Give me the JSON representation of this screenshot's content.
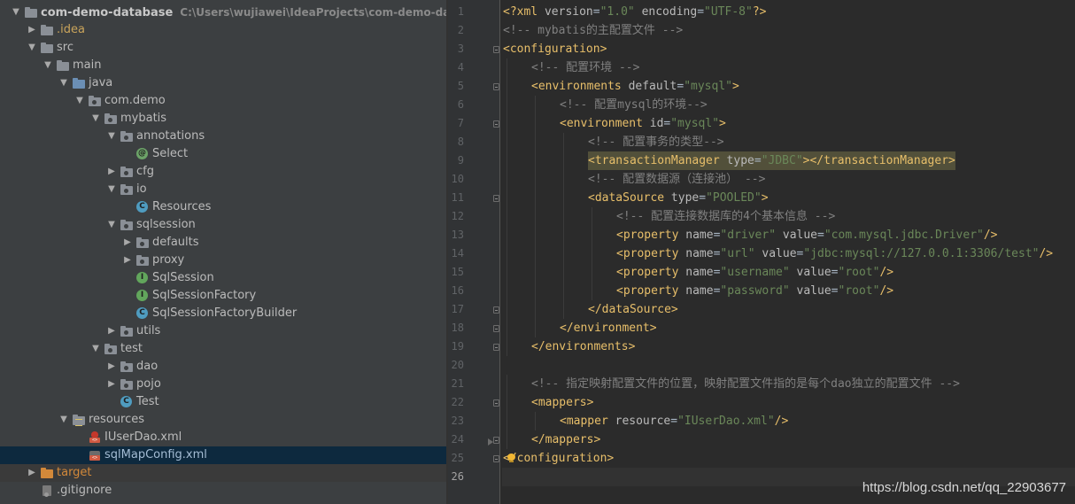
{
  "colors": {
    "tree_bg": "#3c3f41",
    "editor_bg": "#2b2b2b",
    "gutter_bg": "#313335",
    "selection": "#0d293e",
    "tag": "#e8bf6a",
    "attr_value": "#6a8759",
    "comment": "#808080"
  },
  "tree": {
    "project_name": "com-demo-database",
    "project_path": "C:\\Users\\wujiawei\\IdeaProjects\\com-demo-database",
    "items": [
      {
        "label": "com-demo-database",
        "depth": 0,
        "expanded": true,
        "icon": "project-folder-icon",
        "name": "tree-item-project-root"
      },
      {
        "label": ".idea",
        "depth": 1,
        "expanded": false,
        "icon": "folder-icon",
        "name": "tree-item-idea"
      },
      {
        "label": "src",
        "depth": 1,
        "expanded": true,
        "icon": "folder-icon",
        "name": "tree-item-src"
      },
      {
        "label": "main",
        "depth": 2,
        "expanded": true,
        "icon": "folder-icon",
        "name": "tree-item-main"
      },
      {
        "label": "java",
        "depth": 3,
        "expanded": true,
        "icon": "source-root-folder-icon",
        "name": "tree-item-java"
      },
      {
        "label": "com.demo",
        "depth": 4,
        "expanded": true,
        "icon": "package-icon",
        "name": "tree-item-com-demo"
      },
      {
        "label": "mybatis",
        "depth": 5,
        "expanded": true,
        "icon": "package-icon",
        "name": "tree-item-mybatis"
      },
      {
        "label": "annotations",
        "depth": 6,
        "expanded": true,
        "icon": "package-icon",
        "name": "tree-item-annotations"
      },
      {
        "label": "Select",
        "depth": 7,
        "expanded": null,
        "icon": "annotation-icon",
        "name": "tree-item-select"
      },
      {
        "label": "cfg",
        "depth": 6,
        "expanded": false,
        "icon": "package-icon",
        "name": "tree-item-cfg"
      },
      {
        "label": "io",
        "depth": 6,
        "expanded": true,
        "icon": "package-icon",
        "name": "tree-item-io"
      },
      {
        "label": "Resources",
        "depth": 7,
        "expanded": null,
        "icon": "class-icon",
        "name": "tree-item-resources-class"
      },
      {
        "label": "sqlsession",
        "depth": 6,
        "expanded": true,
        "icon": "package-icon",
        "name": "tree-item-sqlsession"
      },
      {
        "label": "defaults",
        "depth": 7,
        "expanded": false,
        "icon": "package-icon",
        "name": "tree-item-defaults"
      },
      {
        "label": "proxy",
        "depth": 7,
        "expanded": false,
        "icon": "package-icon",
        "name": "tree-item-proxy"
      },
      {
        "label": "SqlSession",
        "depth": 7,
        "expanded": null,
        "icon": "interface-icon",
        "name": "tree-item-sqlsession-interface"
      },
      {
        "label": "SqlSessionFactory",
        "depth": 7,
        "expanded": null,
        "icon": "interface-icon",
        "name": "tree-item-sqlsessionfactory"
      },
      {
        "label": "SqlSessionFactoryBuilder",
        "depth": 7,
        "expanded": null,
        "icon": "class-icon",
        "name": "tree-item-sqlsessionfactorybuilder"
      },
      {
        "label": "utils",
        "depth": 6,
        "expanded": false,
        "icon": "package-icon",
        "name": "tree-item-utils"
      },
      {
        "label": "test",
        "depth": 5,
        "expanded": true,
        "icon": "package-icon",
        "name": "tree-item-test-pkg"
      },
      {
        "label": "dao",
        "depth": 6,
        "expanded": false,
        "icon": "package-icon",
        "name": "tree-item-dao"
      },
      {
        "label": "pojo",
        "depth": 6,
        "expanded": false,
        "icon": "package-icon",
        "name": "tree-item-pojo"
      },
      {
        "label": "Test",
        "depth": 6,
        "expanded": null,
        "icon": "class-icon",
        "name": "tree-item-test-class"
      },
      {
        "label": "resources",
        "depth": 3,
        "expanded": true,
        "icon": "resources-folder-icon",
        "name": "tree-item-resources-folder"
      },
      {
        "label": "IUserDao.xml",
        "depth": 4,
        "expanded": null,
        "icon": "mybatis-xml-icon",
        "name": "tree-item-iuserdao-xml"
      },
      {
        "label": "sqlMapConfig.xml",
        "depth": 4,
        "expanded": null,
        "icon": "xml-file-icon",
        "name": "tree-item-sqlmapconfig-xml",
        "selected": true
      },
      {
        "label": "target",
        "depth": 1,
        "expanded": false,
        "icon": "excluded-folder-icon",
        "name": "tree-item-target",
        "excluded": true
      },
      {
        "label": ".gitignore",
        "depth": 1,
        "expanded": null,
        "icon": "gitignore-icon",
        "name": "tree-item-gitignore"
      }
    ]
  },
  "editor": {
    "current_line": 26,
    "lines": [
      {
        "n": "1",
        "indent": 0,
        "fold": false,
        "tokens": [
          [
            "pi",
            "<?xml "
          ],
          [
            "attr",
            "version"
          ],
          [
            "txt",
            "="
          ],
          [
            "val",
            "\"1.0\""
          ],
          [
            "txt",
            " "
          ],
          [
            "attr",
            "encoding"
          ],
          [
            "txt",
            "="
          ],
          [
            "val",
            "\"UTF-8\""
          ],
          [
            "pi",
            "?>"
          ]
        ]
      },
      {
        "n": "2",
        "indent": 0,
        "fold": false,
        "tokens": [
          [
            "cmt",
            "<!-- mybatis的主配置文件 -->"
          ]
        ]
      },
      {
        "n": "3",
        "indent": 0,
        "fold": true,
        "tokens": [
          [
            "tag",
            "<configuration>"
          ]
        ]
      },
      {
        "n": "4",
        "indent": 1,
        "fold": false,
        "tokens": [
          [
            "cmt",
            "<!-- 配置环境 -->"
          ]
        ]
      },
      {
        "n": "5",
        "indent": 1,
        "fold": true,
        "tokens": [
          [
            "tag",
            "<environments "
          ],
          [
            "attr",
            "default"
          ],
          [
            "txt",
            "="
          ],
          [
            "val",
            "\"mysql\""
          ],
          [
            "tag",
            ">"
          ]
        ]
      },
      {
        "n": "6",
        "indent": 2,
        "fold": false,
        "tokens": [
          [
            "cmt",
            "<!-- 配置mysql的环境-->"
          ]
        ]
      },
      {
        "n": "7",
        "indent": 2,
        "fold": true,
        "tokens": [
          [
            "tag",
            "<environment "
          ],
          [
            "attr",
            "id"
          ],
          [
            "txt",
            "="
          ],
          [
            "val",
            "\"mysql\""
          ],
          [
            "tag",
            ">"
          ]
        ]
      },
      {
        "n": "8",
        "indent": 3,
        "fold": false,
        "tokens": [
          [
            "cmt",
            "<!-- 配置事务的类型-->"
          ]
        ]
      },
      {
        "n": "9",
        "indent": 3,
        "fold": false,
        "highlight": true,
        "tokens": [
          [
            "tag",
            "<transactionManager "
          ],
          [
            "attr",
            "type"
          ],
          [
            "txt",
            "="
          ],
          [
            "val",
            "\"JDBC\""
          ],
          [
            "tag",
            "></transactionManager>"
          ]
        ]
      },
      {
        "n": "10",
        "indent": 3,
        "fold": false,
        "tokens": [
          [
            "cmt",
            "<!-- 配置数据源（连接池） -->"
          ]
        ]
      },
      {
        "n": "11",
        "indent": 3,
        "fold": true,
        "tokens": [
          [
            "tag",
            "<dataSource "
          ],
          [
            "attr",
            "type"
          ],
          [
            "txt",
            "="
          ],
          [
            "val",
            "\"POOLED\""
          ],
          [
            "tag",
            ">"
          ]
        ]
      },
      {
        "n": "12",
        "indent": 4,
        "fold": false,
        "tokens": [
          [
            "cmt",
            "<!-- 配置连接数据库的4个基本信息 -->"
          ]
        ]
      },
      {
        "n": "13",
        "indent": 4,
        "fold": false,
        "tokens": [
          [
            "tag",
            "<property "
          ],
          [
            "attr",
            "name"
          ],
          [
            "txt",
            "="
          ],
          [
            "val",
            "\"driver\""
          ],
          [
            "txt",
            " "
          ],
          [
            "attr",
            "value"
          ],
          [
            "txt",
            "="
          ],
          [
            "val",
            "\"com.mysql.jdbc.Driver\""
          ],
          [
            "tag",
            "/>"
          ]
        ]
      },
      {
        "n": "14",
        "indent": 4,
        "fold": false,
        "tokens": [
          [
            "tag",
            "<property "
          ],
          [
            "attr",
            "name"
          ],
          [
            "txt",
            "="
          ],
          [
            "val",
            "\"url\""
          ],
          [
            "txt",
            " "
          ],
          [
            "attr",
            "value"
          ],
          [
            "txt",
            "="
          ],
          [
            "val",
            "\"jdbc:mysql://127.0.0.1:3306/test\""
          ],
          [
            "tag",
            "/>"
          ]
        ]
      },
      {
        "n": "15",
        "indent": 4,
        "fold": false,
        "tokens": [
          [
            "tag",
            "<property "
          ],
          [
            "attr",
            "name"
          ],
          [
            "txt",
            "="
          ],
          [
            "val",
            "\"username\""
          ],
          [
            "txt",
            " "
          ],
          [
            "attr",
            "value"
          ],
          [
            "txt",
            "="
          ],
          [
            "val",
            "\"root\""
          ],
          [
            "tag",
            "/>"
          ]
        ]
      },
      {
        "n": "16",
        "indent": 4,
        "fold": false,
        "tokens": [
          [
            "tag",
            "<property "
          ],
          [
            "attr",
            "name"
          ],
          [
            "txt",
            "="
          ],
          [
            "val",
            "\"password\""
          ],
          [
            "txt",
            " "
          ],
          [
            "attr",
            "value"
          ],
          [
            "txt",
            "="
          ],
          [
            "val",
            "\"root\""
          ],
          [
            "tag",
            "/>"
          ]
        ]
      },
      {
        "n": "17",
        "indent": 3,
        "fold": true,
        "tokens": [
          [
            "tag",
            "</dataSource>"
          ]
        ]
      },
      {
        "n": "18",
        "indent": 2,
        "fold": true,
        "tokens": [
          [
            "tag",
            "</environment>"
          ]
        ]
      },
      {
        "n": "19",
        "indent": 1,
        "fold": true,
        "tokens": [
          [
            "tag",
            "</environments>"
          ]
        ]
      },
      {
        "n": "20",
        "indent": 0,
        "fold": false,
        "tokens": []
      },
      {
        "n": "21",
        "indent": 1,
        "fold": false,
        "tokens": [
          [
            "cmt",
            "<!-- 指定映射配置文件的位置，映射配置文件指的是每个dao独立的配置文件 -->"
          ]
        ]
      },
      {
        "n": "22",
        "indent": 1,
        "fold": true,
        "tokens": [
          [
            "tag",
            "<mappers>"
          ]
        ]
      },
      {
        "n": "23",
        "indent": 2,
        "fold": false,
        "tokens": [
          [
            "tag",
            "<mapper "
          ],
          [
            "attr",
            "resource"
          ],
          [
            "txt",
            "="
          ],
          [
            "val",
            "\"IUserDao.xml\""
          ],
          [
            "tag",
            "/>"
          ]
        ]
      },
      {
        "n": "24",
        "indent": 1,
        "fold": true,
        "tokens": [
          [
            "tag",
            "</mappers>"
          ]
        ]
      },
      {
        "n": "25",
        "indent": 0,
        "fold": true,
        "bulb": true,
        "tokens": [
          [
            "tag",
            "</configuration>"
          ]
        ]
      },
      {
        "n": "26",
        "indent": 0,
        "fold": false,
        "tokens": []
      }
    ]
  },
  "watermark": "https://blog.csdn.net/qq_22903677"
}
